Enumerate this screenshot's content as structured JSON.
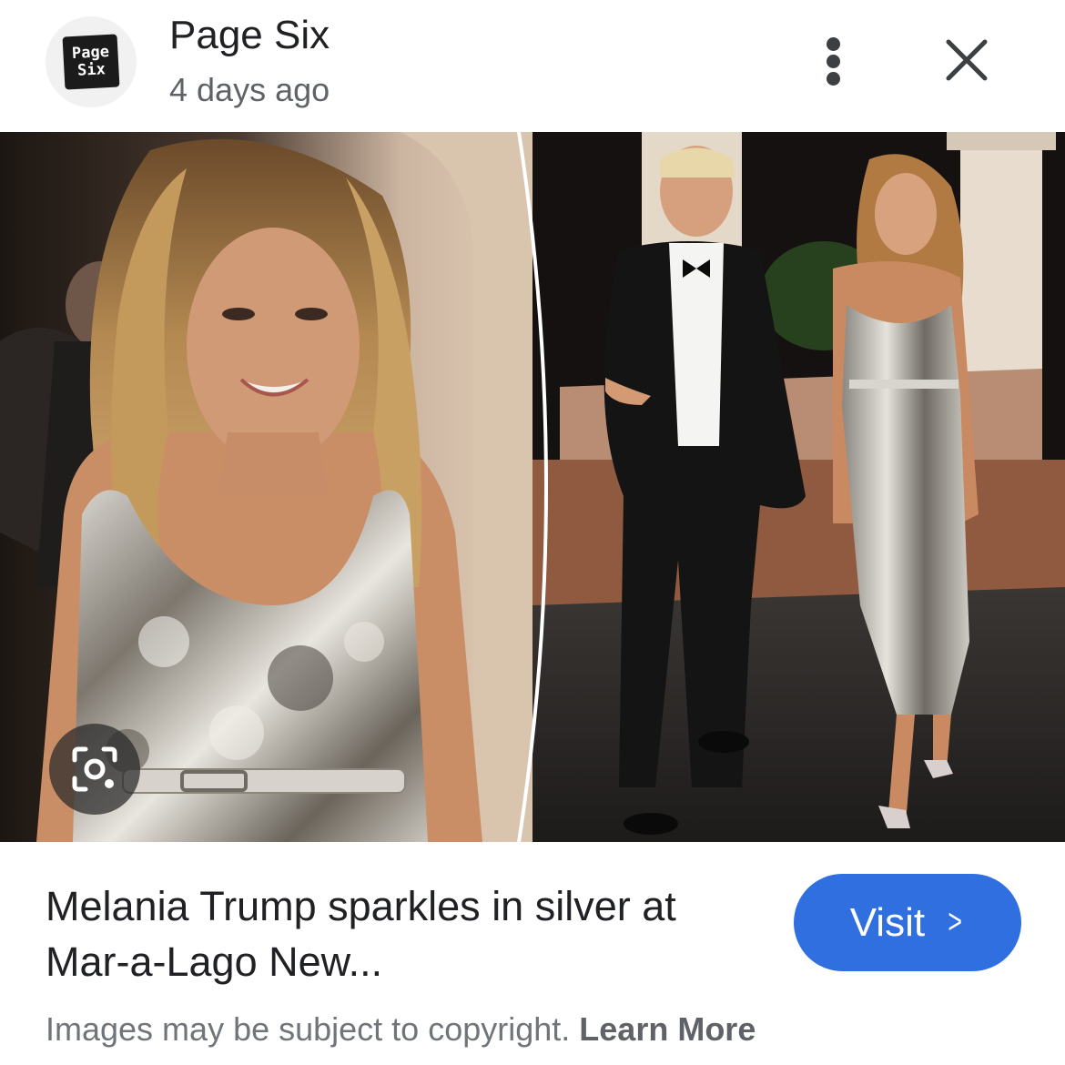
{
  "header": {
    "logo_line1": "Page",
    "logo_line2": "Six",
    "source_name": "Page Six",
    "time_ago": "4 days ago"
  },
  "icons": {
    "more": "more-vert-icon",
    "close": "close-icon",
    "lens": "google-lens-icon"
  },
  "caption": {
    "title": "Melania Trump sparkles in silver at Mar-a-Lago New...",
    "visit_label": "Visit",
    "copyright_text": "Images may be subject to copyright. ",
    "learn_more": "Learn More"
  },
  "colors": {
    "accent": "#2f6fdf",
    "title_text": "#202124",
    "muted_text": "#70757a"
  }
}
